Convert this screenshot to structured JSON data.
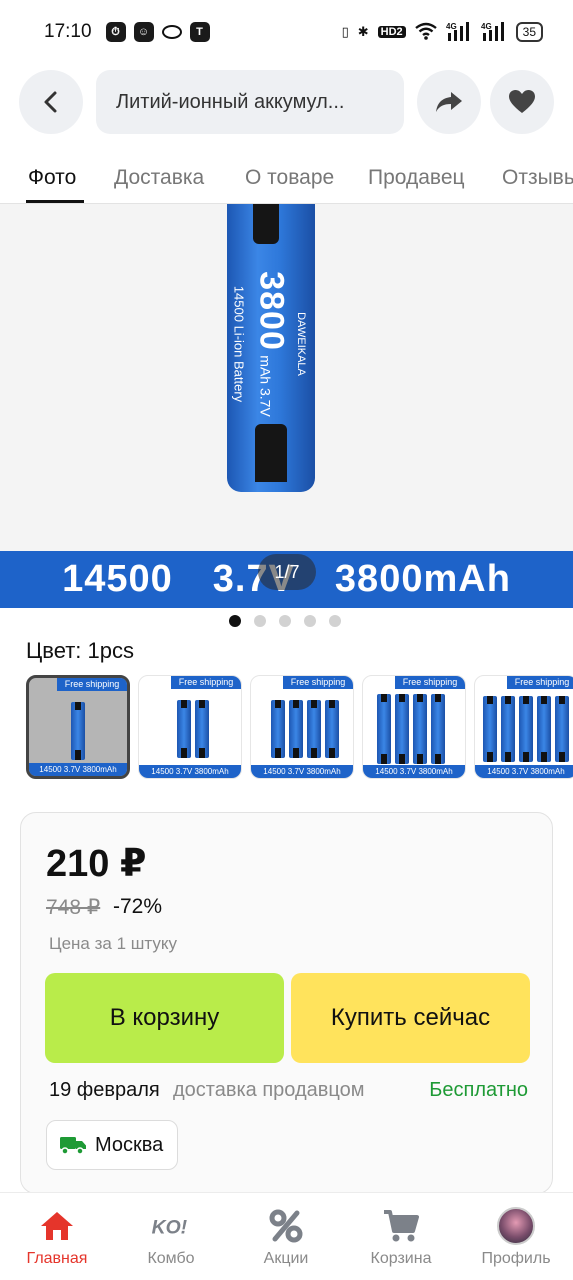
{
  "status_bar": {
    "time": "17:10",
    "network_1": "4G",
    "network_2": "4G",
    "hd": "HD2",
    "battery": "35"
  },
  "header": {
    "search_text": "Литий-ионный аккумул..."
  },
  "tabs": [
    {
      "label": "Фото",
      "active": true
    },
    {
      "label": "Доставка"
    },
    {
      "label": "О товаре"
    },
    {
      "label": "Продавец"
    },
    {
      "label": "Отзывы"
    }
  ],
  "gallery": {
    "counter": "1/7",
    "total_dots": 5,
    "active_dot": 0,
    "battery_brand": "DAWEIKALA",
    "battery_capacity": "3800",
    "battery_spec": "mAh 3.7V",
    "battery_type": "14500 Li-ion Battery",
    "banner_model": "14500",
    "banner_voltage": "3.7V",
    "banner_capacity": "3800mAh"
  },
  "color_option": {
    "label": "Цвет: 1pcs",
    "thumb_ship": "Free shipping",
    "thumb_caption": "14500 3.7V 3800mAh"
  },
  "price": {
    "current": "210 ₽",
    "old": "748 ₽",
    "discount": "-72%",
    "per_unit": "Цена за 1 штуку"
  },
  "buttons": {
    "add_to_cart": "В корзину",
    "buy_now": "Купить сейчас"
  },
  "delivery": {
    "date": "19 февраля",
    "by": "доставка продавцом",
    "price": "Бесплатно",
    "city": "Москва"
  },
  "bottom_nav": [
    {
      "label": "Главная",
      "icon": "home-icon",
      "active": true
    },
    {
      "label": "Комбо",
      "icon": "combo-icon"
    },
    {
      "label": "Акции",
      "icon": "percent-icon"
    },
    {
      "label": "Корзина",
      "icon": "cart-icon"
    },
    {
      "label": "Профиль",
      "icon": "avatar"
    }
  ],
  "colors": {
    "accent_red": "#e5352b",
    "cart_green": "#b9ec4a",
    "buy_yellow": "#ffe35c",
    "free_green": "#1e9a35",
    "banner_blue": "#1e63c9"
  }
}
